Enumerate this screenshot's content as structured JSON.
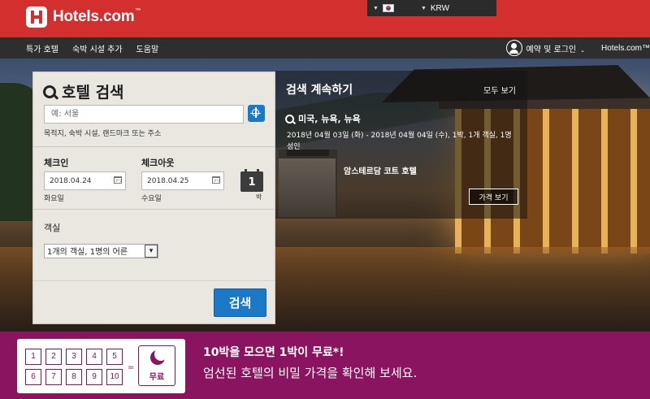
{
  "header": {
    "logo_text": "Hotels.com",
    "logo_tm": "™",
    "country_flag": "korea-flag",
    "currency": "KRW"
  },
  "nav": {
    "items": [
      {
        "label": "특가 호텔"
      },
      {
        "label": "숙박 시설 추가"
      },
      {
        "label": "도움말"
      }
    ],
    "login_label": "예약 및 로그인",
    "brand_label": "Hotels.com™"
  },
  "search": {
    "title": "호텔 검색",
    "destination_placeholder": "예: 서울",
    "destination_hint": "목적지, 숙박 시설, 랜드마크 또는 주소",
    "checkin_label": "체크인",
    "checkin_value": "2018.04.24",
    "checkin_dow": "화요일",
    "checkout_label": "체크아웃",
    "checkout_value": "2018.04.25",
    "checkout_dow": "수요일",
    "nights": "1",
    "nights_unit": "박",
    "rooms_label": "객실",
    "rooms_value": "1개의 객실, 1명의 어른",
    "submit_label": "검색"
  },
  "recent": {
    "title": "검색 계속하기",
    "view_all": "모두 보기",
    "destination": "미국, 뉴욕, 뉴욕",
    "detail": "2018년 04월 03일 (화) - 2018년 04월 04일 (수), 1박, 1개 객실, 1명 성인",
    "hotel_name": "암스테르담 코트 호텔",
    "price_button": "가격 보기"
  },
  "promo": {
    "stamps": [
      "1",
      "2",
      "3",
      "4",
      "5",
      "6",
      "7",
      "8",
      "9",
      "10"
    ],
    "equals": "=",
    "free_label": "무료",
    "title": "10박을 모으면 1박이 무료*!",
    "subtitle": "엄선된 호텔의 비밀 가격을 확인해 보세요."
  },
  "colors": {
    "brand_red": "#d32f2f",
    "nav_dark": "#2e2e2e",
    "search_blue": "#1b79c8",
    "promo_magenta": "#8a1460"
  }
}
